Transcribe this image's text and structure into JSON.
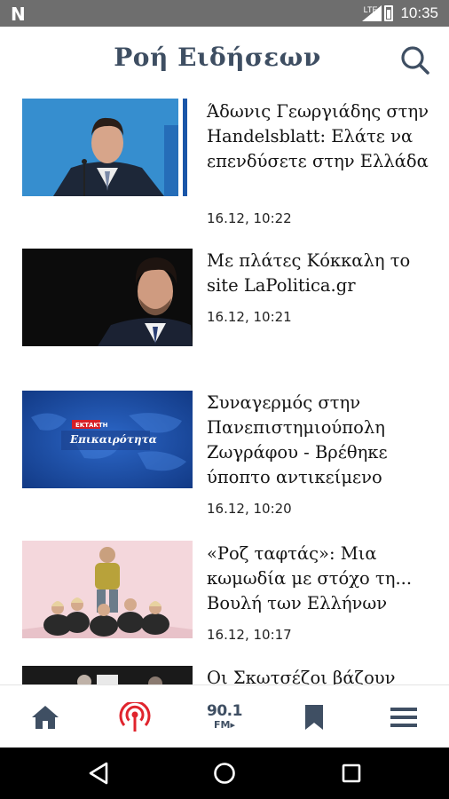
{
  "status_bar": {
    "app_badge": "N",
    "network": "LTE",
    "time": "10:35"
  },
  "header": {
    "title": "Ροή Ειδήσεων",
    "search_icon": "search-icon"
  },
  "articles": [
    {
      "headline": "Άδωνις Γεωργιάδης στην Handelsblatt: Ελάτε να επενδύσετε στην Ελλάδα",
      "datetime": "16.12, 10:22"
    },
    {
      "headline": "Με πλάτες Κόκκαλη το site LaPolitica.gr",
      "datetime": "16.12, 10:21"
    },
    {
      "headline": "Συναγερμός στην Πανεπιστημιούπολη Ζωγράφου - Βρέθηκε ύποπτο αντικείμενο",
      "datetime": "16.12, 10:20",
      "image_caption_small": "ΕΚΤΑΚΤΗ",
      "image_caption": "Επικαιρότητα"
    },
    {
      "headline": "«Ροζ ταφτάς»: Μια κωμωδία με στόχο τη... Βουλή των Ελλήνων",
      "datetime": "16.12, 10:17"
    },
    {
      "headline": "Οι Σκωτσέζοι βάζουν"
    }
  ],
  "bottom_nav": {
    "items": [
      "home-icon",
      "live-radio-icon",
      "radio-901",
      "bookmark-icon",
      "menu-icon"
    ],
    "radio_number": "90.1",
    "radio_fm": "FM▸",
    "active_color": "#e0242d",
    "icon_color": "#3f4f63"
  },
  "android_nav": [
    "back-icon",
    "home-circle-icon",
    "recents-icon"
  ]
}
